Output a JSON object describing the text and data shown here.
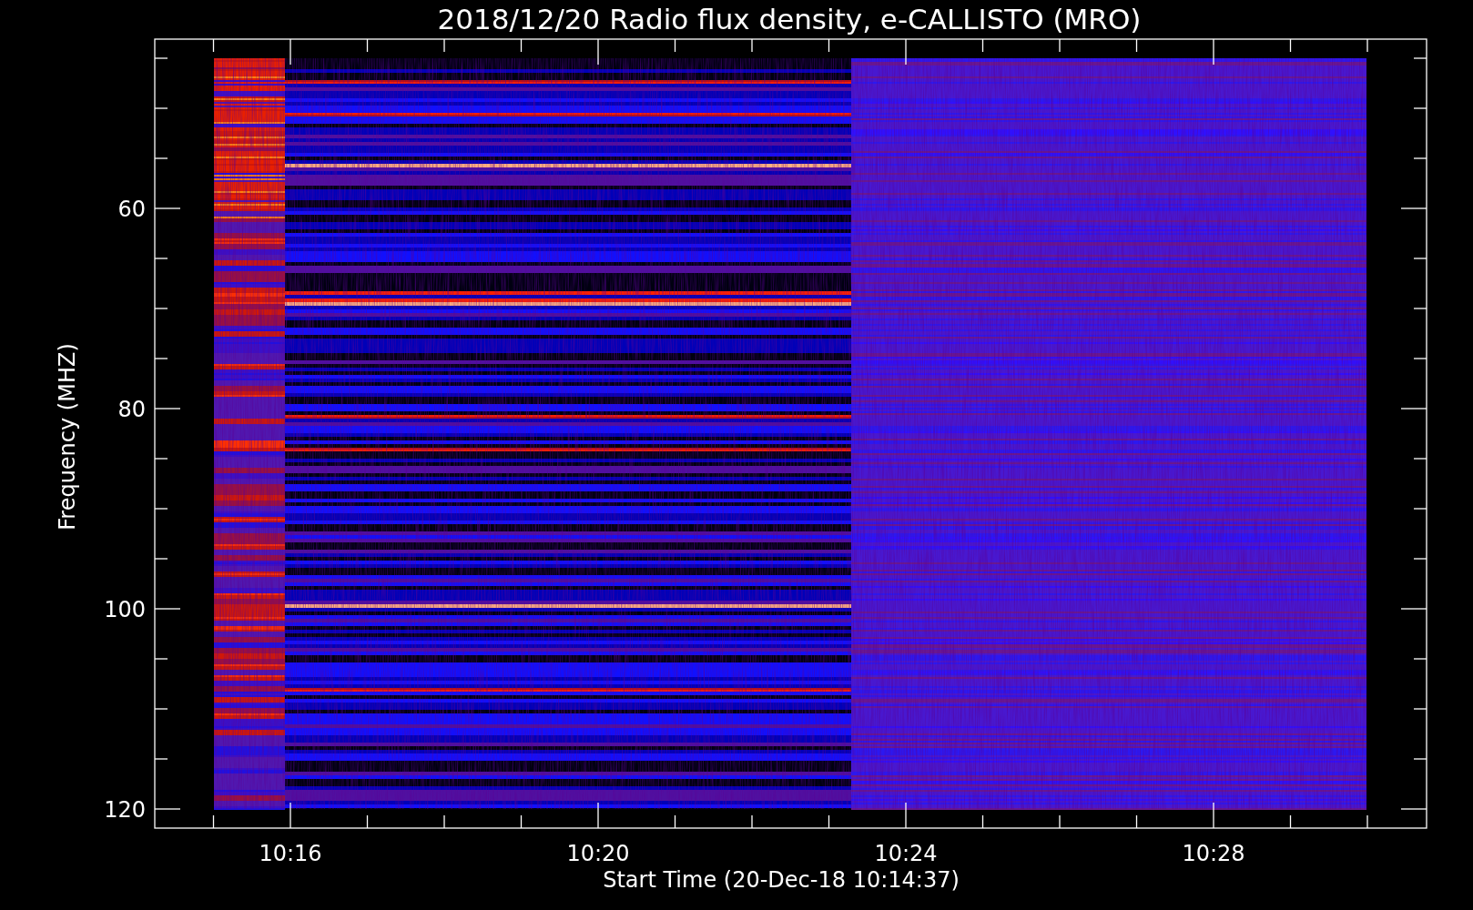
{
  "title": "2018/12/20  Radio flux density, e-CALLISTO (MRO)",
  "x_axis": {
    "label": "Start Time (20-Dec-18 10:14:37)",
    "ticks": [
      "10:16",
      "10:20",
      "10:24",
      "10:28"
    ]
  },
  "y_axis": {
    "label": "Frequency (MHZ)",
    "ticks": [
      "60",
      "80",
      "100",
      "120"
    ]
  }
}
